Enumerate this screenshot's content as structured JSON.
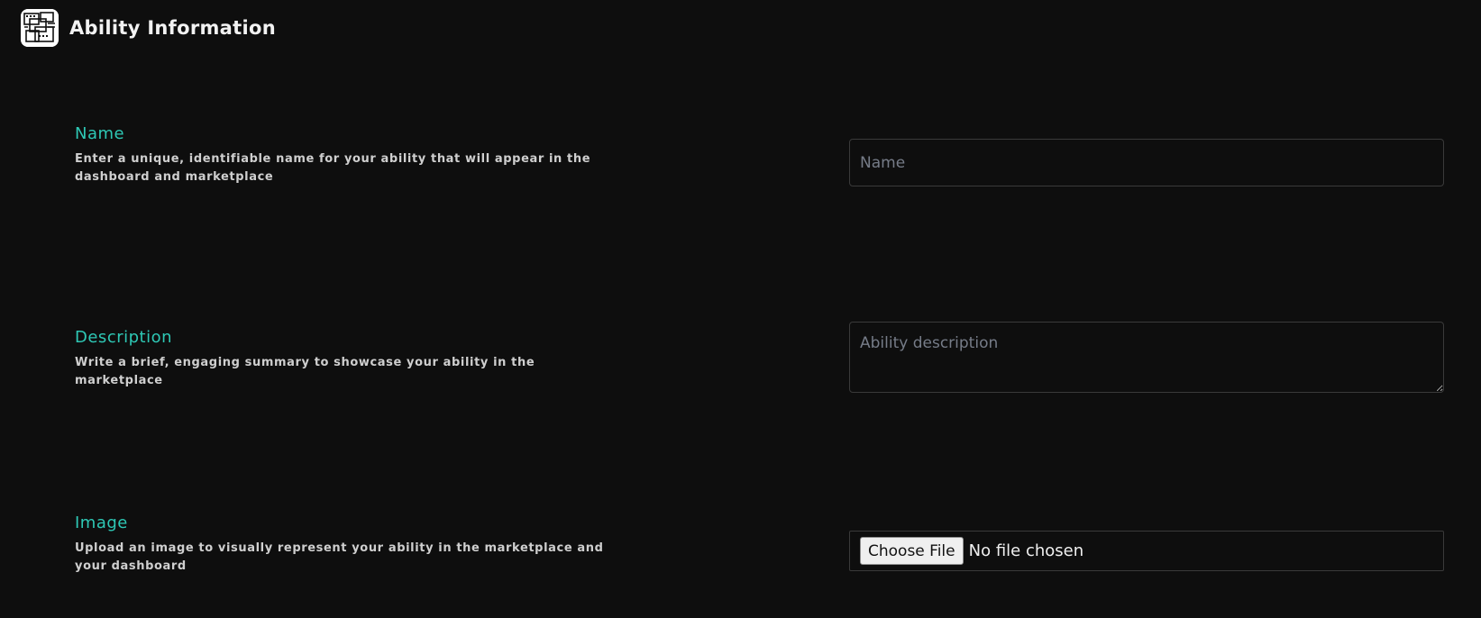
{
  "header": {
    "title": "Ability Information",
    "logo_icon": "maze-logo-icon"
  },
  "fields": {
    "name": {
      "label": "Name",
      "description": "Enter a unique, identifiable name for your ability that will appear in the dashboard and marketplace",
      "placeholder": "Name",
      "value": ""
    },
    "description": {
      "label": "Description",
      "description": "Write a brief, engaging summary to showcase your ability in the marketplace",
      "placeholder": "Ability description",
      "value": ""
    },
    "image": {
      "label": "Image",
      "description": "Upload an image to visually represent your ability in the marketplace and your dashboard",
      "button_label": "Choose File",
      "status": "No file chosen"
    }
  },
  "colors": {
    "background": "#0e0e0e",
    "accent": "#2ec8b5",
    "border": "#3a3a3a"
  }
}
